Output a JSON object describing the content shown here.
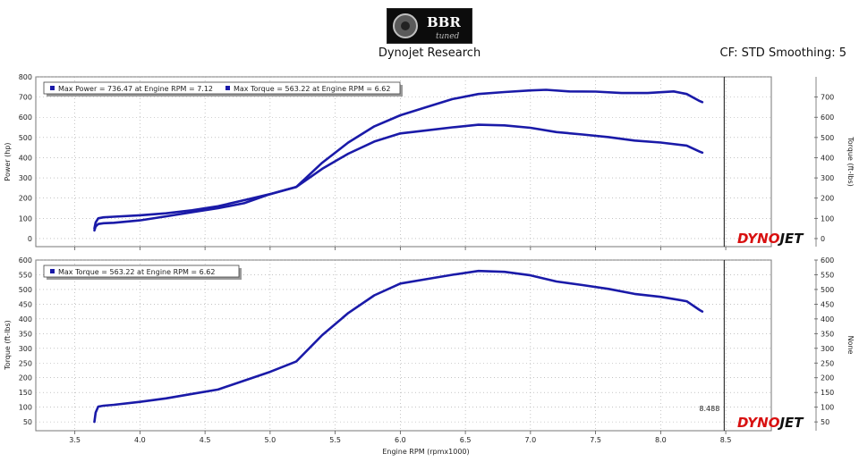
{
  "header": {
    "title": "Dynojet Research",
    "correction": "CF: STD Smoothing: 5",
    "logo_text": "BBR",
    "logo_subtext": "tuned"
  },
  "watermark": {
    "part1": "DYNO",
    "part2": "JET"
  },
  "colors": {
    "curve": "#1a1aa8",
    "grid": "#a0a0a0",
    "cursor": "#111111",
    "accent": "#d81010"
  },
  "cursor": {
    "x": 8.488,
    "label": "8.488"
  },
  "x_axis": {
    "label": "Engine RPM (rpmx1000)",
    "range": [
      3.2,
      8.85
    ],
    "ticks": [
      "3.5",
      "4.0",
      "4.5",
      "5.0",
      "5.5",
      "6.0",
      "6.5",
      "7.0",
      "7.5",
      "8.0",
      "8.5"
    ]
  },
  "chart_data": [
    {
      "type": "line",
      "ylabel": "Power (hp)",
      "y2label": "Torque (ft-lbs)",
      "ylim": [
        -40,
        800
      ],
      "y_ticks": [
        "800",
        "700",
        "600",
        "500",
        "400",
        "300",
        "200",
        "100",
        "0"
      ],
      "y2_ticks": [
        "700",
        "600",
        "500",
        "400",
        "300",
        "200",
        "100",
        "0"
      ],
      "legend": [
        "Max Power = 736.47 at Engine RPM = 7.12",
        "Max Torque = 563.22 at Engine RPM = 6.62"
      ],
      "series": [
        {
          "x": [
            3.65,
            3.66,
            3.68,
            3.72,
            3.8,
            4.0,
            4.2,
            4.4,
            4.6,
            4.8,
            5.0,
            5.2,
            5.4,
            5.6,
            5.8,
            6.0,
            6.2,
            6.4,
            6.6,
            6.8,
            7.0,
            7.12,
            7.3,
            7.5,
            7.7,
            7.9,
            8.1,
            8.2,
            8.3,
            8.32
          ],
          "y": [
            50,
            80,
            100,
            105,
            108,
            115,
            125,
            140,
            160,
            190,
            220,
            255,
            375,
            475,
            555,
            610,
            650,
            690,
            715,
            725,
            733,
            736,
            728,
            727,
            720,
            720,
            728,
            715,
            680,
            675
          ]
        },
        {
          "x": [
            3.65,
            3.66,
            3.68,
            3.72,
            3.8,
            4.0,
            4.2,
            4.4,
            4.6,
            4.8,
            5.0,
            5.2,
            5.4,
            5.6,
            5.8,
            6.0,
            6.2,
            6.4,
            6.6,
            6.8,
            7.0,
            7.2,
            7.4,
            7.6,
            7.8,
            8.0,
            8.2,
            8.3,
            8.32
          ],
          "y": [
            40,
            60,
            72,
            76,
            78,
            90,
            110,
            130,
            150,
            175,
            220,
            255,
            345,
            420,
            480,
            520,
            535,
            550,
            563,
            560,
            548,
            527,
            515,
            502,
            485,
            475,
            460,
            430,
            425
          ]
        }
      ]
    },
    {
      "type": "line",
      "ylabel": "Torque (ft-lbs)",
      "y2label": "None",
      "ylim": [
        20,
        600
      ],
      "y_ticks": [
        "600",
        "550",
        "500",
        "450",
        "400",
        "350",
        "300",
        "250",
        "200",
        "150",
        "100",
        "50"
      ],
      "y2_ticks": [
        "600",
        "550",
        "500",
        "450",
        "400",
        "350",
        "300",
        "250",
        "200",
        "150",
        "100",
        "50"
      ],
      "legend": [
        "Max Torque = 563.22 at Engine RPM = 6.62"
      ],
      "series": [
        {
          "x": [
            3.65,
            3.66,
            3.68,
            3.72,
            3.8,
            4.0,
            4.2,
            4.4,
            4.6,
            4.8,
            5.0,
            5.2,
            5.4,
            5.6,
            5.8,
            6.0,
            6.2,
            6.4,
            6.6,
            6.8,
            7.0,
            7.2,
            7.4,
            7.6,
            7.8,
            8.0,
            8.2,
            8.3,
            8.32
          ],
          "y": [
            50,
            82,
            102,
            105,
            108,
            118,
            130,
            145,
            160,
            190,
            220,
            255,
            345,
            420,
            480,
            520,
            535,
            550,
            563,
            560,
            548,
            527,
            515,
            502,
            485,
            475,
            460,
            430,
            425
          ]
        }
      ]
    }
  ],
  "hp_label": "Power (hp)",
  "none_label": "None"
}
